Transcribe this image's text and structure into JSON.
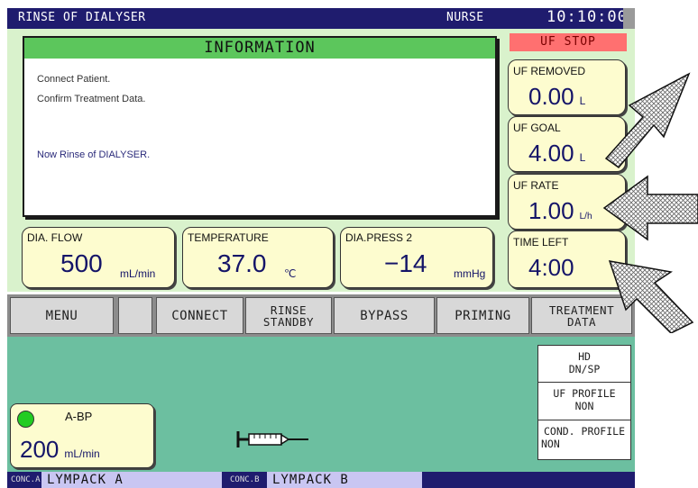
{
  "header": {
    "mode": "RINSE OF DIALYSER",
    "user": "NURSE",
    "clock": "10:10:00"
  },
  "info": {
    "title": "INFORMATION",
    "lines": [
      "Connect Patient.",
      "Confirm Treatment Data.",
      "Now Rinse of DIALYSER."
    ]
  },
  "uf_status": "UF STOP",
  "uf": {
    "removed": {
      "label": "UF REMOVED",
      "value": "0.00",
      "unit": "L"
    },
    "goal": {
      "label": "UF GOAL",
      "value": "4.00",
      "unit": "L"
    },
    "rate": {
      "label": "UF RATE",
      "value": "1.00",
      "unit": "L/h"
    },
    "time_left": {
      "label": "TIME LEFT",
      "value": "4:00"
    }
  },
  "readings": {
    "dia_flow": {
      "label": "DIA. FLOW",
      "value": "500",
      "unit": "mL/min"
    },
    "temperature": {
      "label": "TEMPERATURE",
      "value": "37.0",
      "unit": "℃"
    },
    "dia_press": {
      "label": "DIA.PRESS 2",
      "value": "−14",
      "unit": "mmHg"
    }
  },
  "buttons": {
    "menu": "MENU",
    "connect": "CONNECT",
    "rinse_standby_1": "RINSE",
    "rinse_standby_2": "STANDBY",
    "bypass": "BYPASS",
    "priming": "PRIMING",
    "treatment_1": "TREATMENT",
    "treatment_2": "DATA"
  },
  "abp": {
    "label": "A-BP",
    "value": "200",
    "unit": "mL/min"
  },
  "side_panel": {
    "mode_1": "HD",
    "mode_2": "DN/SP",
    "uf_profile_1": "UF PROFILE",
    "uf_profile_2": "NON",
    "cond_profile_1": "COND. PROFILE",
    "cond_profile_2": "NON"
  },
  "conc": {
    "a_label": "CONC.A",
    "a_value": "LYMPACK A",
    "b_label": "CONC.B",
    "b_value": "LYMPACK B"
  },
  "colors": {
    "title_bar": "#1f1c6e",
    "upper_panel": "#d9f2cc",
    "lower_panel": "#6cbfa0",
    "info_header": "#5cc65c",
    "uf_stop": "#ff7070",
    "value_box": "#fdfccf",
    "value_text": "#141468"
  },
  "icons": [
    "syringe-icon",
    "status-dot-icon",
    "arrow-icon"
  ]
}
